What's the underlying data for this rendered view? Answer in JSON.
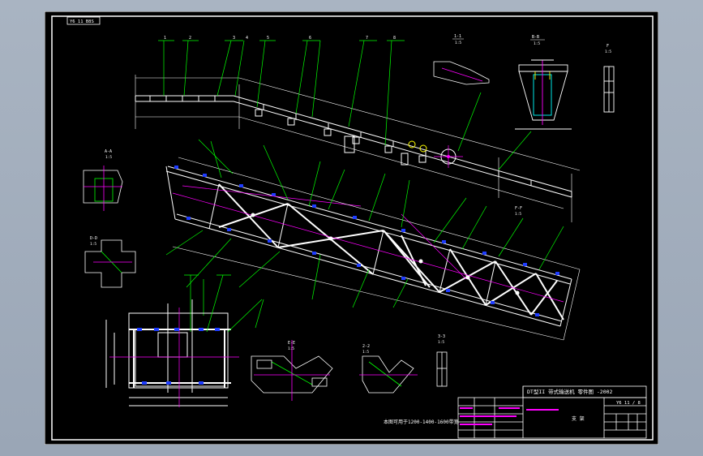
{
  "drawing": {
    "sheet_tag": "Y6 11 B8S",
    "title_text": "DT型II 带式输送机 零件图 -2002",
    "code_text": "Y6 11 / 8",
    "center_label": "支 架",
    "caption_text": "本图可用于1200-1400-1600带宽",
    "sections": [
      {
        "id": "sec-1",
        "label": "1-1",
        "scale": "1:5"
      },
      {
        "id": "sec-2",
        "label": "B-B",
        "scale": "1:5"
      },
      {
        "id": "sec-3",
        "label": "F",
        "scale": "1:5"
      },
      {
        "id": "sec-4",
        "label": "A-A",
        "scale": "1:5"
      },
      {
        "id": "sec-5",
        "label": "D-D",
        "scale": "1:5"
      },
      {
        "id": "sec-6",
        "label": "E-E",
        "scale": "1:5"
      },
      {
        "id": "sec-7",
        "label": "2-2",
        "scale": "1:5"
      },
      {
        "id": "sec-8",
        "label": "3-3",
        "scale": "1:5"
      },
      {
        "id": "sec-9",
        "label": "F-F",
        "scale": "1:5"
      }
    ]
  },
  "colors": {
    "canvas_bg": "#000000",
    "line": "#ffffff",
    "leader": "#00ff00",
    "center": "#ff00ff",
    "accent": "#ffff00",
    "dim": "#00ffff"
  }
}
